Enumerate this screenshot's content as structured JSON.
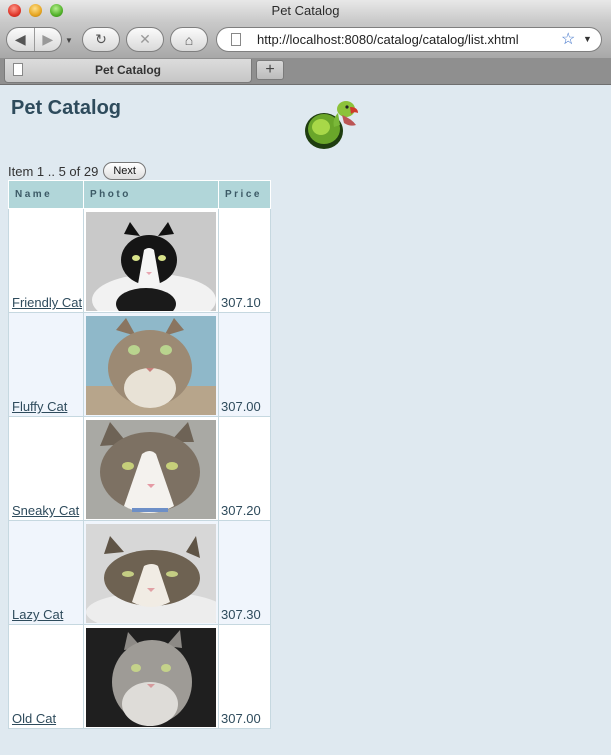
{
  "window": {
    "title": "Pet Catalog"
  },
  "toolbar": {
    "url": "http://localhost:8080/catalog/catalog/list.xhtml"
  },
  "tabs": [
    {
      "label": "Pet Catalog"
    }
  ],
  "page": {
    "title": "Pet Catalog",
    "pager_text": "Item 1 .. 5 of 29",
    "next_label": "Next",
    "columns": [
      "Name",
      "Photo",
      "Price"
    ],
    "items": [
      {
        "name": "Friendly Cat",
        "price": "307.10",
        "photo": "cat-black-white-icon"
      },
      {
        "name": "Fluffy Cat",
        "price": "307.00",
        "photo": "cat-tabby-looking-up-icon"
      },
      {
        "name": "Sneaky Cat",
        "price": "307.20",
        "photo": "cat-tabby-white-icon"
      },
      {
        "name": "Lazy Cat",
        "price": "307.30",
        "photo": "cat-lying-tabby-icon"
      },
      {
        "name": "Old Cat",
        "price": "307.00",
        "photo": "cat-grey-fluffy-icon"
      }
    ]
  },
  "colors": {
    "page_background": "#dfe9f0",
    "header_background": "#b1d6d9",
    "text": "#2e4b5c"
  }
}
